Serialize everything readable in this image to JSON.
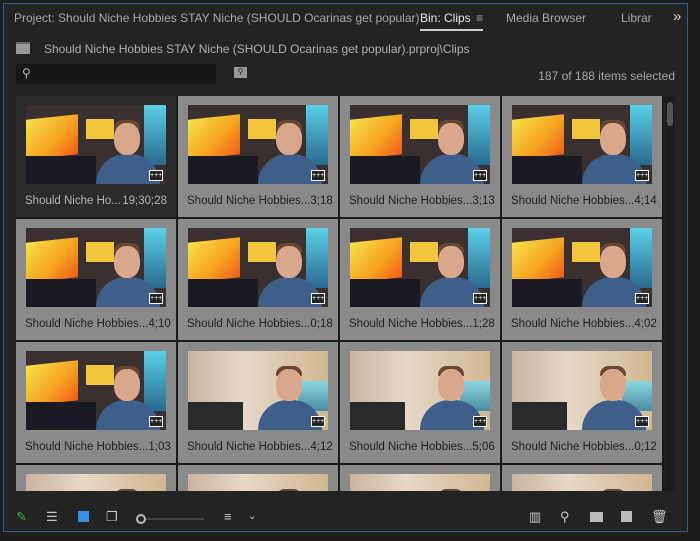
{
  "tabs": {
    "project": "Project: Should Niche Hobbies STAY Niche (SHOULD Ocarinas get popular)",
    "bin": "Bin: Clips",
    "menu": "≡",
    "media_browser": "Media Browser",
    "libraries": "Librar",
    "overflow": "»"
  },
  "path": "Should Niche Hobbies STAY Niche (SHOULD Ocarinas get popular).prproj\\Clips",
  "search": {
    "placeholder": "",
    "value": ""
  },
  "selection_count": "187 of 188 items selected",
  "clips": [
    {
      "name": "Should Niche Ho...",
      "duration": "19;30;28",
      "selected": false
    },
    {
      "name": "Should Niche Hobbies...",
      "duration": "3;18",
      "selected": true
    },
    {
      "name": "Should Niche Hobbies...",
      "duration": "3;13",
      "selected": true
    },
    {
      "name": "Should Niche Hobbies...",
      "duration": "4;14",
      "selected": true
    },
    {
      "name": "Should Niche Hobbies...",
      "duration": "4;10",
      "selected": true
    },
    {
      "name": "Should Niche Hobbies...",
      "duration": "0;18",
      "selected": true
    },
    {
      "name": "Should Niche Hobbies...",
      "duration": "1;28",
      "selected": true
    },
    {
      "name": "Should Niche Hobbies...",
      "duration": "4;02",
      "selected": true
    },
    {
      "name": "Should Niche Hobbies...",
      "duration": "1;03",
      "selected": true
    },
    {
      "name": "Should Niche Hobbies...",
      "duration": "4;12",
      "selected": true
    },
    {
      "name": "Should Niche Hobbies...",
      "duration": "5;06",
      "selected": true
    },
    {
      "name": "Should Niche Hobbies...",
      "duration": "0;12",
      "selected": true
    }
  ],
  "zoom_slider": 0.0,
  "colors": {
    "accent": "#2d5f96",
    "selected_cell": "#8a8a8a"
  }
}
